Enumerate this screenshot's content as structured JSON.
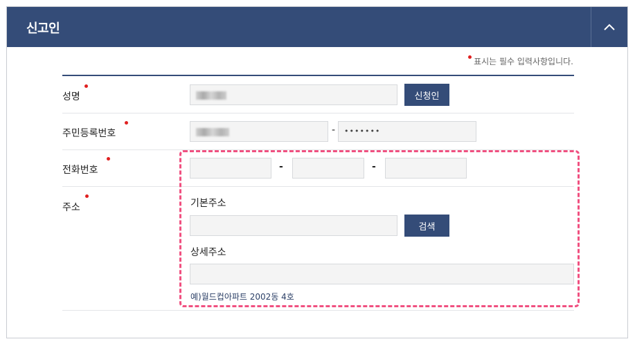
{
  "header": {
    "title": "신고인"
  },
  "required_note": "표시는 필수 입력사항입니다.",
  "fields": {
    "name": {
      "label": "성명",
      "button": "신청인"
    },
    "resident_id": {
      "label": "주민등록번호",
      "separator": "-",
      "back_masked": "•••••••"
    },
    "phone": {
      "label": "전화번호",
      "separator1": "-",
      "separator2": "-"
    },
    "address": {
      "label": "주소",
      "basic_label": "기본주소",
      "search_button": "검색",
      "detail_label": "상세주소",
      "example": "예)월드컵아파트 2002동 4호"
    }
  },
  "colors": {
    "header": "#344c78",
    "button": "#344c78",
    "required_dot": "#e02020",
    "highlight": "#f05080"
  }
}
